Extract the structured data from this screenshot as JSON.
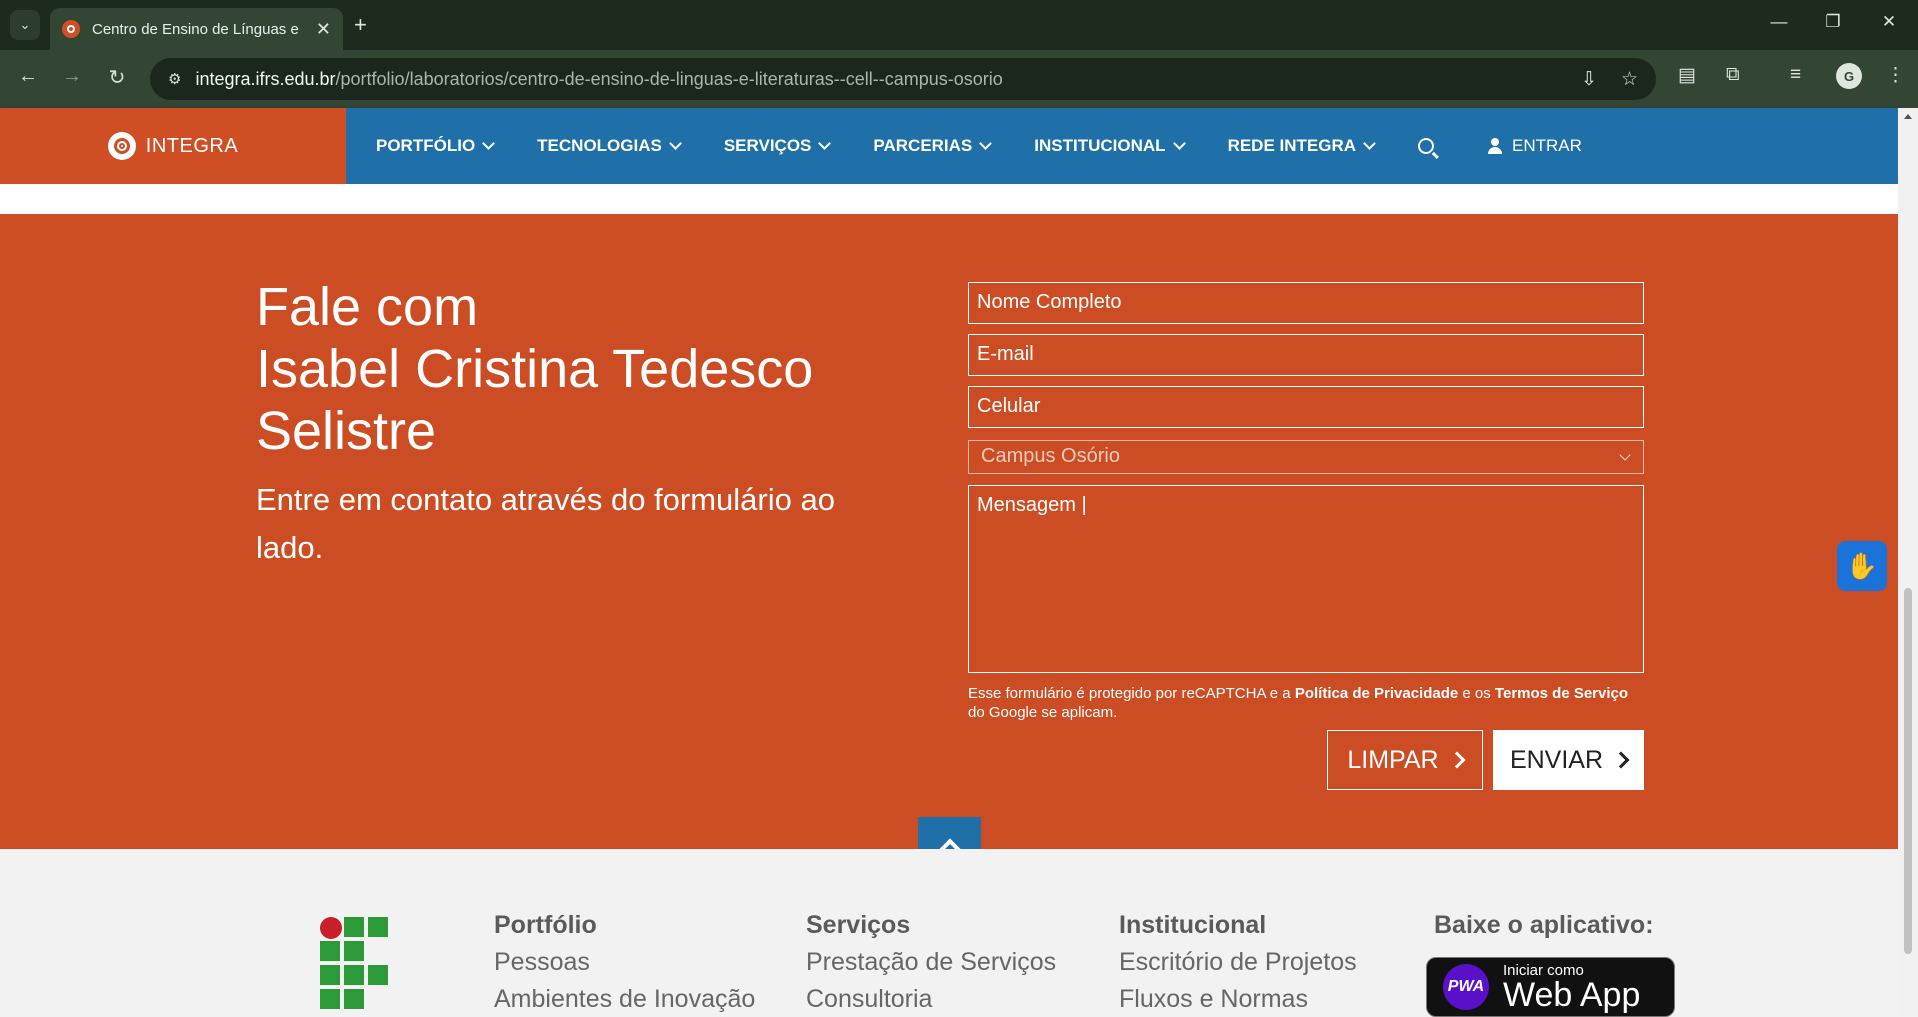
{
  "browser": {
    "tab_title": "Centro de Ensino de Línguas e",
    "new_tab_glyph": "+",
    "url_host": "integra.ifrs.edu.br",
    "url_path": "/portfolio/laboratorios/centro-de-ensino-de-linguas-e-literaturas--cell--campus-osorio"
  },
  "header": {
    "brand": "INTEGRA",
    "nav": [
      "PORTFÓLIO",
      "TECNOLOGIAS",
      "SERVIÇOS",
      "PARCERIAS",
      "INSTITUCIONAL",
      "REDE INTEGRA"
    ],
    "login": "ENTRAR"
  },
  "contact": {
    "title_line1": "Fale com",
    "title_line2": "Isabel Cristina Tedesco",
    "title_line3": "Selistre",
    "subtitle": "Entre em contato através do formulário ao lado.",
    "name_placeholder": "Nome Completo",
    "email_placeholder": "E-mail",
    "phone_placeholder": "Celular",
    "campus_selected": "Campus Osório",
    "message_value": "Mensagem |",
    "recaptcha_pre": "Esse formulário é protegido por reCAPTCHA e a ",
    "recaptcha_privacy": "Política de Privacidade",
    "recaptcha_mid": " e os ",
    "recaptcha_terms": "Termos de Serviço",
    "recaptcha_post": " do Google se aplicam.",
    "clear_label": "LIMPAR",
    "send_label": "ENVIAR"
  },
  "footer": {
    "col1": {
      "heading": "Portfólio",
      "links": [
        "Pessoas",
        "Ambientes de Inovação"
      ]
    },
    "col2": {
      "heading": "Serviços",
      "links": [
        "Prestação de Serviços",
        "Consultoria"
      ]
    },
    "col3": {
      "heading": "Institucional",
      "links": [
        "Escritório de Projetos",
        "Fluxos e Normas"
      ]
    },
    "app_heading": "Baixe o aplicativo:",
    "pwa_badge": "PWA",
    "webapp_small": "Iniciar como",
    "webapp_big": "Web App"
  },
  "colors": {
    "brand_orange": "#cc4d23",
    "nav_blue": "#1f6fa8",
    "ifrs_green": "#2d9a38",
    "ifrs_red": "#c8202a"
  }
}
